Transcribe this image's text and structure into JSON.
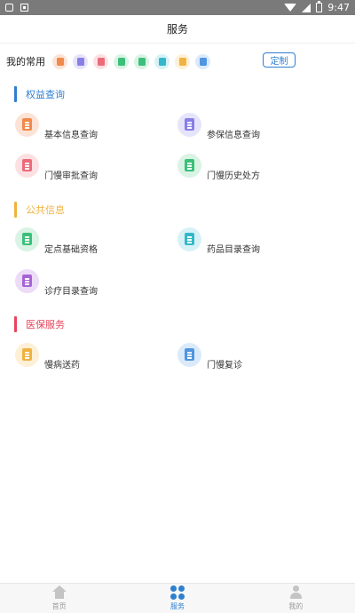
{
  "status_bar": {
    "time": "9:47"
  },
  "header": {
    "title": "服务"
  },
  "favorites": {
    "label": "我的常用",
    "custom_button": "定制",
    "icons": [
      {
        "name": "record-icon",
        "bg": "#fde3d6",
        "fg": "#f08a4b"
      },
      {
        "name": "card-icon",
        "bg": "#e6e4fb",
        "fg": "#8a7ee6"
      },
      {
        "name": "approval-icon",
        "bg": "#fde0e2",
        "fg": "#ec6b7a"
      },
      {
        "name": "prescription-icon",
        "bg": "#d9f3e4",
        "fg": "#3cbf7a"
      },
      {
        "name": "building-icon",
        "bg": "#d9f3e4",
        "fg": "#3cbf7a"
      },
      {
        "name": "pill-icon",
        "bg": "#d6f2f6",
        "fg": "#35b7c9"
      },
      {
        "name": "catalog-icon",
        "bg": "#fdf0d6",
        "fg": "#f0b240"
      },
      {
        "name": "doctor-icon",
        "bg": "#dbeafb",
        "fg": "#4f95e0"
      }
    ]
  },
  "sections": [
    {
      "title": "权益查询",
      "color": "#2f7fd0"
    },
    {
      "title": "公共信息",
      "color": "#f0b240"
    },
    {
      "title": "医保服务",
      "color": "#e8445a"
    }
  ],
  "items": [
    {
      "label": "基本信息查询",
      "bg": "#fde3d6",
      "fg": "#f08a4b"
    },
    {
      "label": "参保信息查询",
      "bg": "#e6e4fb",
      "fg": "#8a7ee6"
    },
    {
      "label": "门慢审批查询",
      "bg": "#fde0e2",
      "fg": "#ec6b7a"
    },
    {
      "label": "门慢历史处方",
      "bg": "#d9f3e4",
      "fg": "#3cbf7a"
    },
    {
      "label": "定点基础资格",
      "bg": "#d9f3e4",
      "fg": "#3cbf7a"
    },
    {
      "label": "药品目录查询",
      "bg": "#d6f2f6",
      "fg": "#35b7c9"
    },
    {
      "label": "诊疗目录查询",
      "bg": "#ecdcf7",
      "fg": "#a763d6"
    },
    {
      "label": "慢病送药",
      "bg": "#fdf0d6",
      "fg": "#f0b240"
    },
    {
      "label": "门慢复诊",
      "bg": "#dbeafb",
      "fg": "#4f95e0"
    }
  ],
  "bottom_nav": [
    {
      "label": "首页"
    },
    {
      "label": "服务"
    },
    {
      "label": "我的"
    }
  ]
}
